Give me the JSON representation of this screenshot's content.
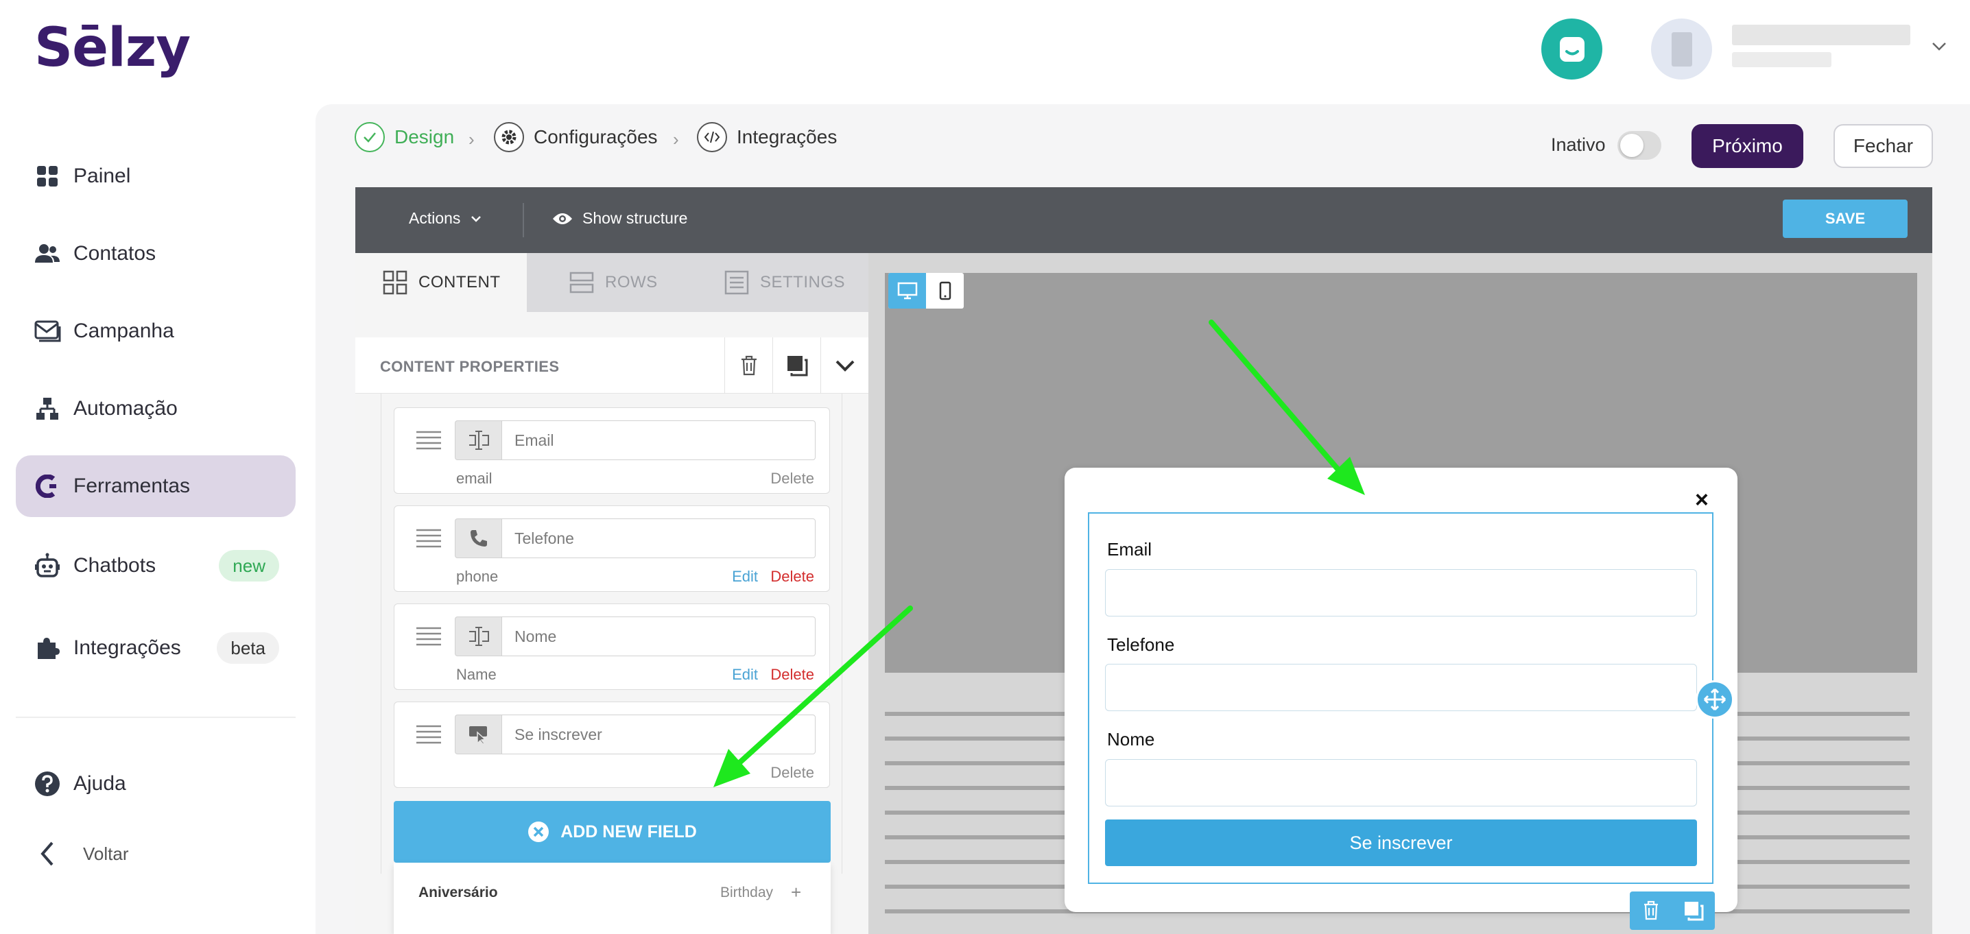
{
  "brand": {
    "logo": "Sēlzy"
  },
  "sidebar": {
    "items": [
      {
        "label": "Painel",
        "icon": "grid-icon"
      },
      {
        "label": "Contatos",
        "icon": "users-icon"
      },
      {
        "label": "Campanha",
        "icon": "mail-icon"
      },
      {
        "label": "Automação",
        "icon": "flow-icon"
      },
      {
        "label": "Ferramentas",
        "icon": "tools-icon",
        "active": true
      },
      {
        "label": "Chatbots",
        "icon": "bot-icon",
        "badge": "new"
      },
      {
        "label": "Integrações",
        "icon": "puzzle-icon",
        "badge": "beta"
      }
    ],
    "help": "Ajuda",
    "back": "Voltar"
  },
  "steps": [
    {
      "label": "Design",
      "status": "done"
    },
    {
      "label": "Configurações",
      "status": "pending"
    },
    {
      "label": "Integrações",
      "status": "pending"
    }
  ],
  "header": {
    "inactive_label": "Inativo",
    "toggle_on": false,
    "next_label": "Próximo",
    "close_label": "Fechar"
  },
  "editor": {
    "actions_label": "Actions",
    "show_structure_label": "Show structure",
    "save_label": "SAVE",
    "tabs": [
      {
        "label": "CONTENT",
        "active": true
      },
      {
        "label": "ROWS",
        "active": false
      },
      {
        "label": "SETTINGS",
        "active": false
      }
    ],
    "content_properties_title": "CONTENT PROPERTIES",
    "fields": [
      {
        "placeholder": "Email",
        "name": "email",
        "edit": "",
        "delete": "Delete",
        "delete_style": "grey",
        "icon": "text-field-icon"
      },
      {
        "placeholder": "Telefone",
        "name": "phone",
        "edit": "Edit",
        "delete": "Delete",
        "delete_style": "red",
        "icon": "phone-icon"
      },
      {
        "placeholder": "Nome",
        "name": "Name",
        "edit": "Edit",
        "delete": "Delete",
        "delete_style": "red",
        "icon": "text-field-icon"
      },
      {
        "placeholder": "Se inscrever",
        "name": "",
        "edit": "",
        "delete": "Delete",
        "delete_style": "grey",
        "icon": "submit-icon"
      }
    ],
    "add_new_field": "ADD NEW FIELD",
    "dropdown": {
      "label": "Aniversário",
      "type": "Birthday",
      "plus": "+"
    }
  },
  "popup": {
    "close": "×",
    "fields": [
      {
        "label": "Email"
      },
      {
        "label": "Telefone"
      },
      {
        "label": "Nome"
      }
    ],
    "submit_label": "Se inscrever"
  },
  "colors": {
    "brand": "#3a1d6b",
    "accent": "#4fb3e4",
    "active_nav": "#ddd6e6",
    "success": "#3fae56",
    "danger": "#d32d2d",
    "annotation_arrow": "#1ee81e"
  }
}
